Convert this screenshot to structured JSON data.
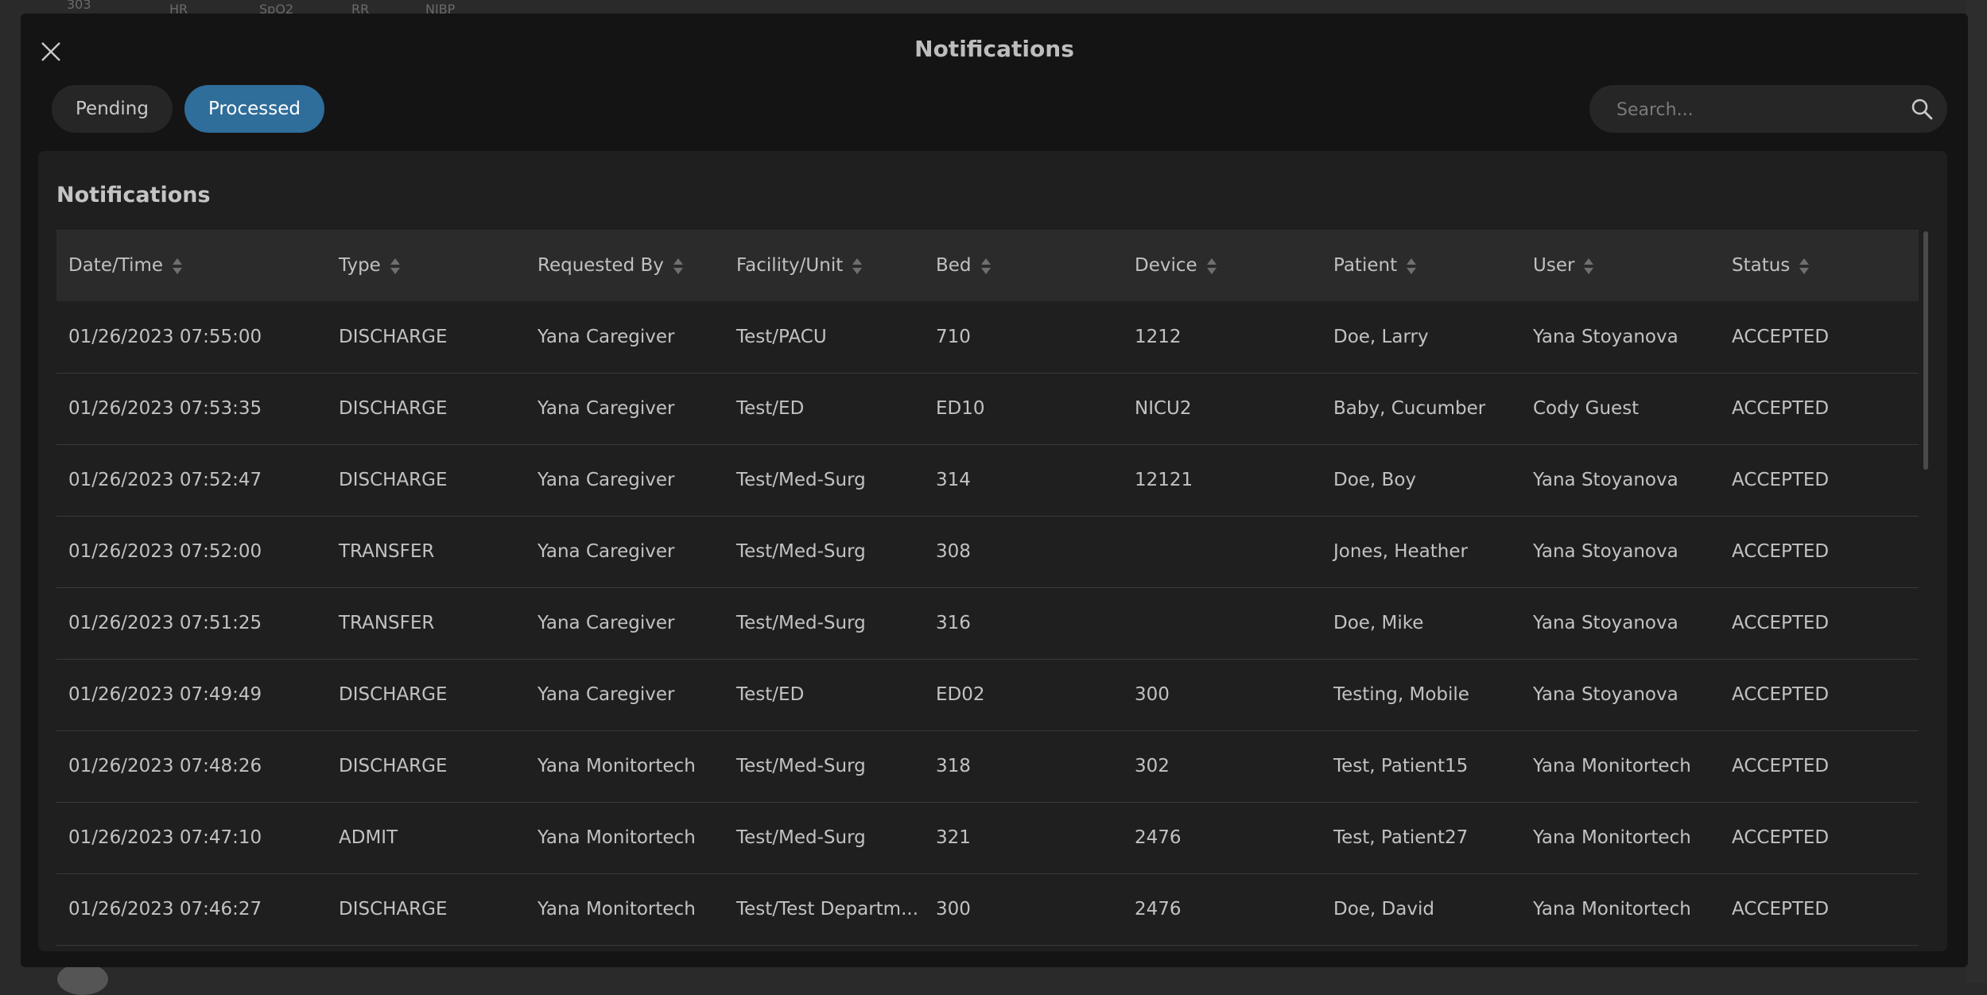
{
  "background": {
    "labels": [
      "303",
      "HR",
      "SpO2",
      "RR",
      "NIBP"
    ]
  },
  "modal": {
    "title": "Notifications",
    "close_icon": "close-icon"
  },
  "tabs": [
    {
      "label": "Pending",
      "active": false
    },
    {
      "label": "Processed",
      "active": true
    }
  ],
  "search": {
    "placeholder": "Search...",
    "value": "",
    "icon": "search-icon"
  },
  "panel": {
    "title": "Notifications"
  },
  "table": {
    "columns": [
      "Date/Time",
      "Type",
      "Requested By",
      "Facility/Unit",
      "Bed",
      "Device",
      "Patient",
      "User",
      "Status"
    ],
    "rows": [
      [
        "01/26/2023 07:55:00",
        "DISCHARGE",
        "Yana Caregiver",
        "Test/PACU",
        "710",
        "1212",
        "Doe, Larry",
        "Yana Stoyanova",
        "ACCEPTED"
      ],
      [
        "01/26/2023 07:53:35",
        "DISCHARGE",
        "Yana Caregiver",
        "Test/ED",
        "ED10",
        "NICU2",
        "Baby, Cucumber",
        "Cody Guest",
        "ACCEPTED"
      ],
      [
        "01/26/2023 07:52:47",
        "DISCHARGE",
        "Yana Caregiver",
        "Test/Med-Surg",
        "314",
        "12121",
        "Doe, Boy",
        "Yana Stoyanova",
        "ACCEPTED"
      ],
      [
        "01/26/2023 07:52:00",
        "TRANSFER",
        "Yana Caregiver",
        "Test/Med-Surg",
        "308",
        "",
        "Jones, Heather",
        "Yana Stoyanova",
        "ACCEPTED"
      ],
      [
        "01/26/2023 07:51:25",
        "TRANSFER",
        "Yana Caregiver",
        "Test/Med-Surg",
        "316",
        "",
        "Doe, Mike",
        "Yana Stoyanova",
        "ACCEPTED"
      ],
      [
        "01/26/2023 07:49:49",
        "DISCHARGE",
        "Yana Caregiver",
        "Test/ED",
        "ED02",
        "300",
        "Testing, Mobile",
        "Yana Stoyanova",
        "ACCEPTED"
      ],
      [
        "01/26/2023 07:48:26",
        "DISCHARGE",
        "Yana Monitortech",
        "Test/Med-Surg",
        "318",
        "302",
        "Test, Patient15",
        "Yana Monitortech",
        "ACCEPTED"
      ],
      [
        "01/26/2023 07:47:10",
        "ADMIT",
        "Yana Monitortech",
        "Test/Med-Surg",
        "321",
        "2476",
        "Test, Patient27",
        "Yana Monitortech",
        "ACCEPTED"
      ],
      [
        "01/26/2023 07:46:27",
        "DISCHARGE",
        "Yana Monitortech",
        "Test/Test Departm...",
        "300",
        "2476",
        "Doe, David",
        "Yana Monitortech",
        "ACCEPTED"
      ]
    ]
  },
  "colors": {
    "active_tab": "#2f6d9a",
    "modal_bg": "#141414",
    "panel_bg": "#1f1f1f"
  }
}
